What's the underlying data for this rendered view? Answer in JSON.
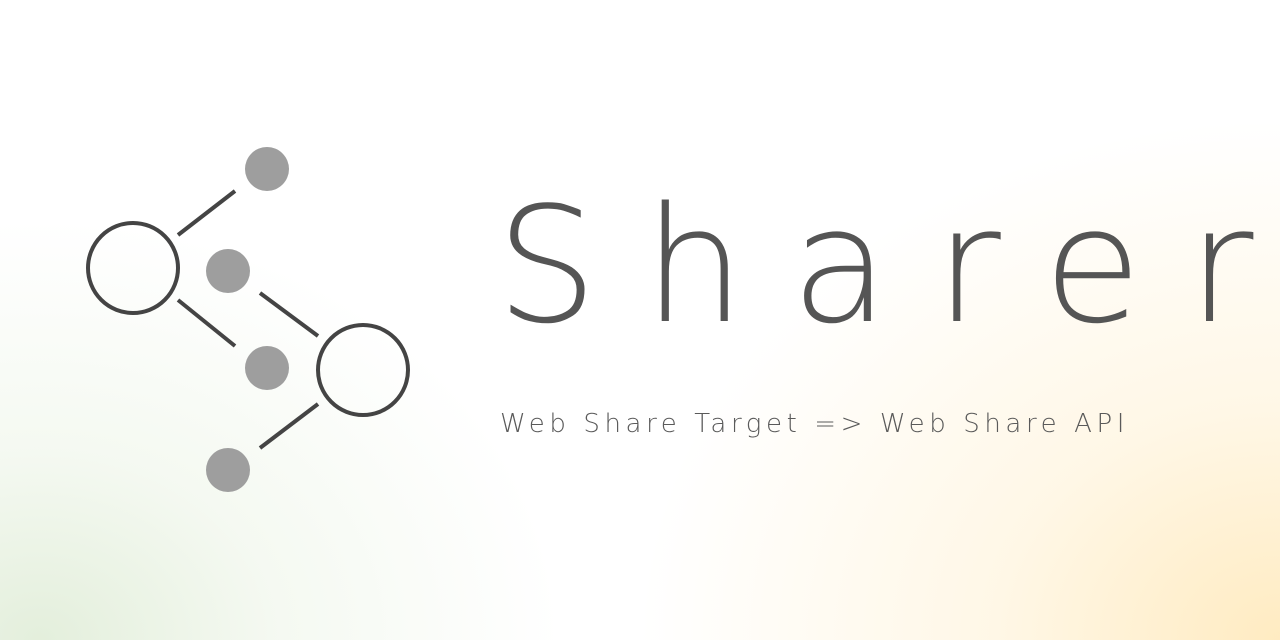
{
  "banner": {
    "title": "Sharer",
    "subtitle": "Web Share Target => Web Share API"
  },
  "logo": {
    "icon": "share-network-icon",
    "outline_color": "#444444",
    "dot_color": "#9e9e9e"
  },
  "colors": {
    "text": "#555555",
    "bottom_left_tint": "#e2eeda",
    "bottom_right_tint": "#ffeabe"
  }
}
